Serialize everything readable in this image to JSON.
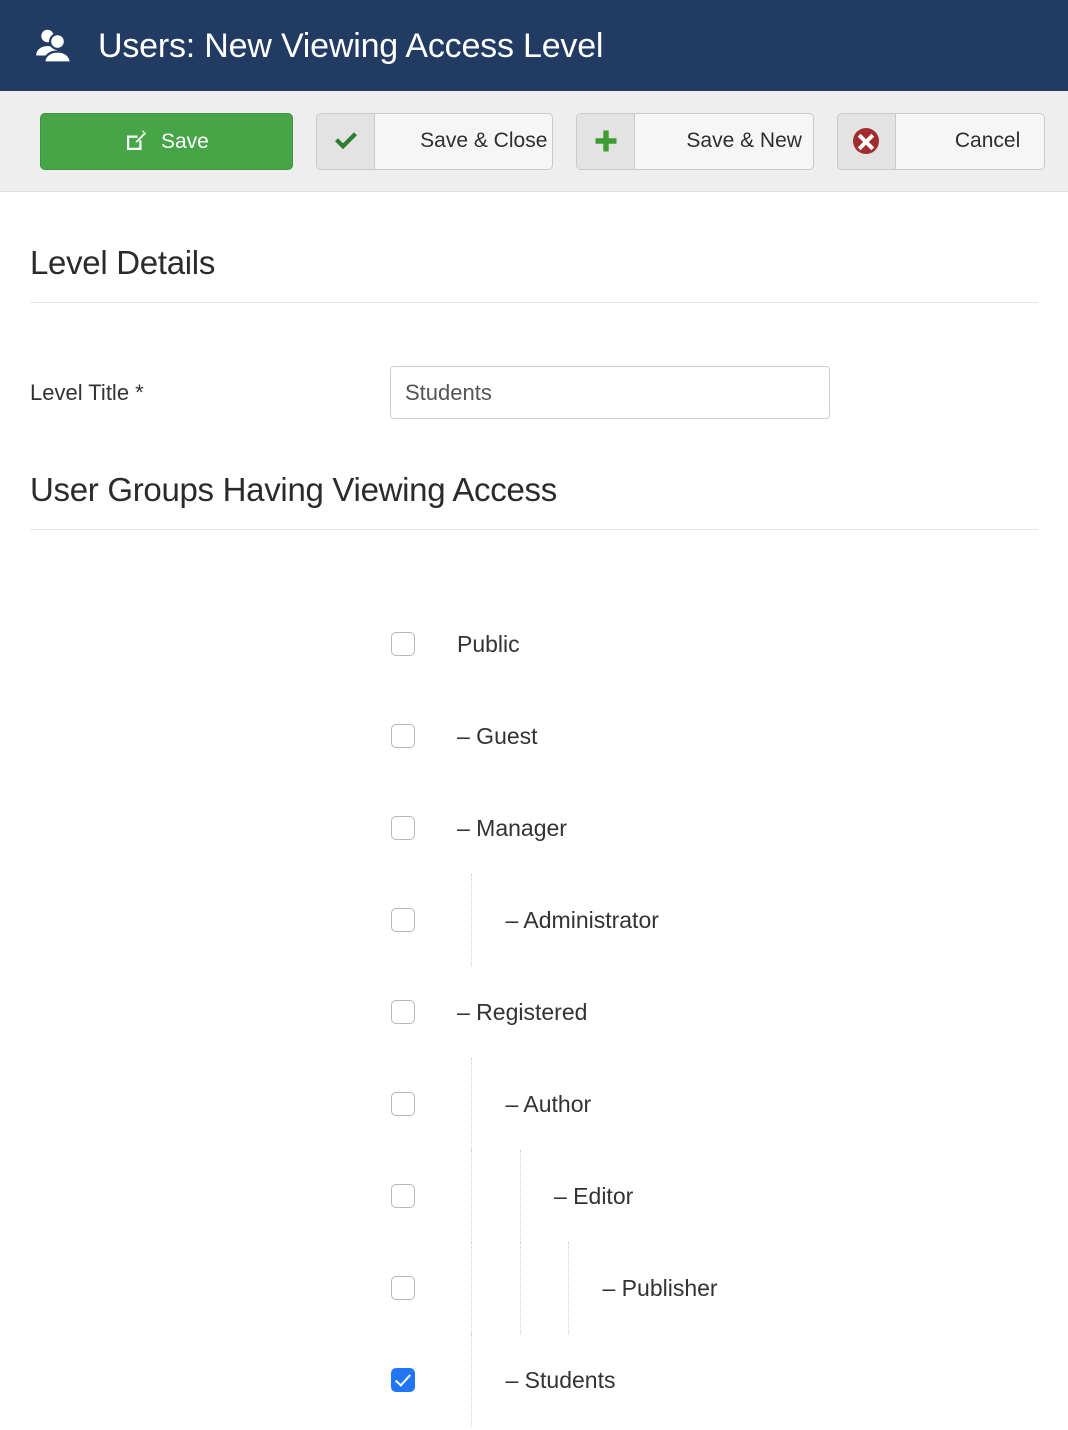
{
  "header": {
    "icon": "users-icon",
    "title": "Users: New Viewing Access Level",
    "background": "#223b63"
  },
  "toolbar": {
    "background": "#eeeeee",
    "buttons": [
      {
        "label": "Save",
        "icon": "edit-pencil-square-icon",
        "style": "primary",
        "color": "#46a546"
      },
      {
        "label": "Save & Close",
        "icon": "check-icon",
        "style": "split",
        "color": "#2e7d32"
      },
      {
        "label": "Save & New",
        "icon": "plus-icon",
        "style": "split",
        "color": "#3f9c35"
      },
      {
        "label": "Cancel",
        "icon": "circle-x-icon",
        "style": "split",
        "color": "#a02c2c"
      }
    ]
  },
  "sections": {
    "level_details": {
      "title": "Level Details",
      "field": {
        "label": "Level Title *",
        "value": "Students",
        "placeholder": "Level Title"
      }
    },
    "user_groups": {
      "title": "User Groups Having Viewing Access",
      "checked_color": "#2176f5",
      "items": [
        {
          "label": "Public",
          "depth": 0,
          "checked": false
        },
        {
          "label": "– Guest",
          "depth": 0,
          "checked": false
        },
        {
          "label": "– Manager",
          "depth": 0,
          "checked": false
        },
        {
          "label": "– Administrator",
          "depth": 1,
          "checked": false
        },
        {
          "label": "– Registered",
          "depth": 0,
          "checked": false
        },
        {
          "label": "– Author",
          "depth": 1,
          "checked": false
        },
        {
          "label": "– Editor",
          "depth": 2,
          "checked": false
        },
        {
          "label": "– Publisher",
          "depth": 3,
          "checked": false
        },
        {
          "label": "– Students",
          "depth": 1,
          "checked": true
        }
      ]
    }
  }
}
